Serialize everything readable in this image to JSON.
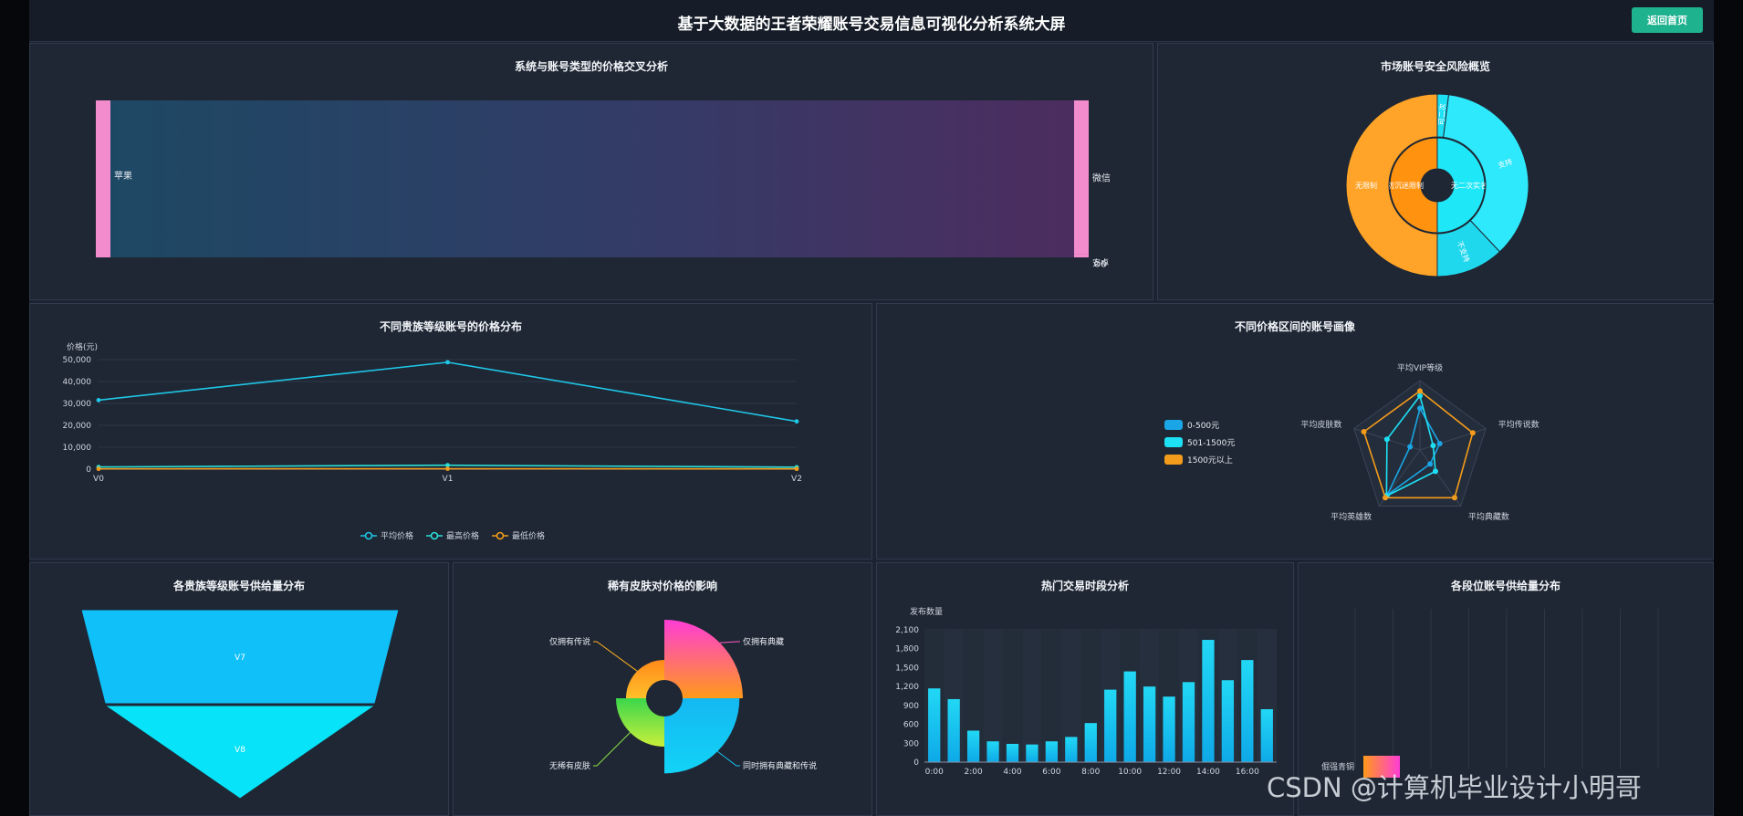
{
  "header": {
    "title": "基于大数据的王者荣耀账号交易信息可视化分析系统大屏",
    "home_button": "返回首页"
  },
  "colors": {
    "accent": "#1fb28f",
    "cyan": "#19c7f5",
    "cyan2": "#1ee9f5",
    "orange": "#f39c1b",
    "pink": "#f28ccd"
  },
  "chart_data": [
    {
      "type": "sankey",
      "title": "系统与账号类型的价格交叉分析",
      "nodes": [
        "苹果",
        "微信",
        "QQ",
        "安卓"
      ],
      "links": [
        {
          "source": "苹果",
          "target": "微信",
          "value": 0.98
        },
        {
          "source": "苹果",
          "target": "QQ",
          "value": 0.02
        }
      ]
    },
    {
      "type": "pie",
      "title": "市场账号安全风险概览",
      "inner": [
        {
          "label": "防沉迷限制",
          "value": 50
        },
        {
          "label": "无二次实名",
          "value": 50
        }
      ],
      "outer": [
        {
          "label": "无限制",
          "value": 50
        },
        {
          "label": "可二次",
          "value": 2
        },
        {
          "label": "支持",
          "value": 36
        },
        {
          "label": "不支持",
          "value": 12
        }
      ]
    },
    {
      "type": "line",
      "title": "不同贵族等级账号的价格分布",
      "ylabel": "价格(元)",
      "categories": [
        "V0",
        "V1",
        "V2"
      ],
      "ylim": [
        0,
        50000
      ],
      "yticks": [
        "0",
        "10,000",
        "20,000",
        "30,000",
        "40,000",
        "50,000"
      ],
      "series": [
        {
          "name": "平均价格",
          "values": [
            31500,
            48800,
            21800
          ]
        },
        {
          "name": "最高价格",
          "values": [
            1000,
            1800,
            900
          ]
        },
        {
          "name": "最低价格",
          "values": [
            150,
            200,
            120
          ]
        }
      ]
    },
    {
      "type": "radar",
      "title": "不同价格区间的账号画像",
      "indicators": [
        "平均VIP等级",
        "平均传说数",
        "平均典藏数",
        "平均英雄数",
        "平均皮肤数"
      ],
      "series": [
        {
          "name": "0-500元",
          "values": [
            0.6,
            0.3,
            0.25,
            0.8,
            0.15
          ]
        },
        {
          "name": "501-1500元",
          "values": [
            0.78,
            0.2,
            0.38,
            0.82,
            0.5
          ]
        },
        {
          "name": "1500元以上",
          "values": [
            0.85,
            0.8,
            0.85,
            0.85,
            0.85
          ]
        }
      ]
    },
    {
      "type": "funnel",
      "title": "各贵族等级账号供给量分布",
      "categories": [
        "V7",
        "V8"
      ],
      "values": [
        100,
        85
      ]
    },
    {
      "type": "pie",
      "title": "稀有皮肤对价格的影响",
      "categories": [
        "仅拥有典藏",
        "同时拥有典藏和传说",
        "无稀有皮肤",
        "仅拥有传说"
      ],
      "values": [
        90,
        85,
        45,
        30
      ]
    },
    {
      "type": "bar",
      "title": "热门交易时段分析",
      "ylabel": "发布数量",
      "categories": [
        "0:00",
        "1:00",
        "2:00",
        "3:00",
        "4:00",
        "5:00",
        "6:00",
        "7:00",
        "8:00",
        "9:00",
        "10:00",
        "11:00",
        "12:00",
        "13:00",
        "14:00",
        "15:00",
        "16:00",
        "17:00"
      ],
      "xticklabels": [
        "0:00",
        "2:00",
        "4:00",
        "6:00",
        "8:00",
        "10:00",
        "12:00",
        "14:00",
        "16:00"
      ],
      "values": [
        1170,
        1000,
        500,
        330,
        290,
        280,
        330,
        400,
        620,
        1150,
        1440,
        1200,
        1040,
        1270,
        1940,
        1300,
        1620,
        840
      ],
      "ylim": [
        0,
        2100
      ],
      "yticks": [
        "0",
        "300",
        "600",
        "900",
        "1,200",
        "1,500",
        "1,800",
        "2,100"
      ]
    },
    {
      "type": "bar",
      "title": "各段位账号供给量分布",
      "categories": [
        "倔强青铜"
      ]
    }
  ],
  "watermark": "CSDN @计算机毕业设计小明哥"
}
